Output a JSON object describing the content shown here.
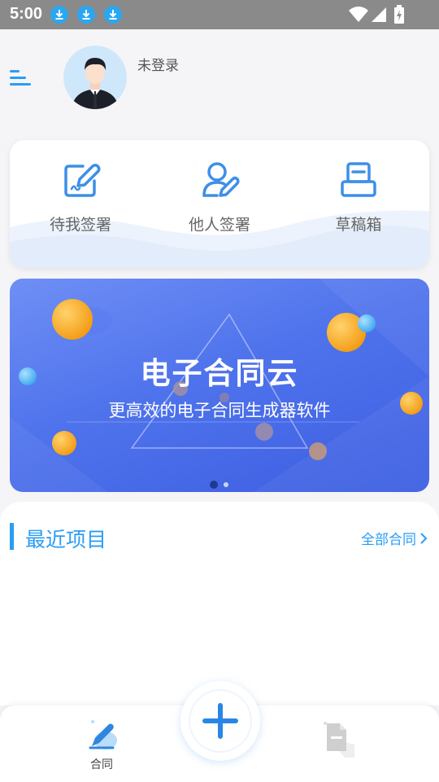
{
  "status_bar": {
    "time": "5:00"
  },
  "user": {
    "login_status": "未登录"
  },
  "quick_actions": [
    {
      "label": "待我签署",
      "icon": "sign-pen-icon"
    },
    {
      "label": "他人签署",
      "icon": "person-pen-icon"
    },
    {
      "label": "草稿箱",
      "icon": "drafts-box-icon"
    }
  ],
  "banner": {
    "title": "电子合同云",
    "subtitle": "更高效的电子合同生成器软件",
    "active_slide": 1,
    "slide_count": 2
  },
  "recent": {
    "title": "最近项目",
    "all_link": "全部合同"
  },
  "tabbar": {
    "contract_label": "合同"
  },
  "colors": {
    "accent": "#2a9df4",
    "status_bar": "#8a8a8a",
    "banner": "#4f73ec",
    "orb": "#f6a623"
  }
}
